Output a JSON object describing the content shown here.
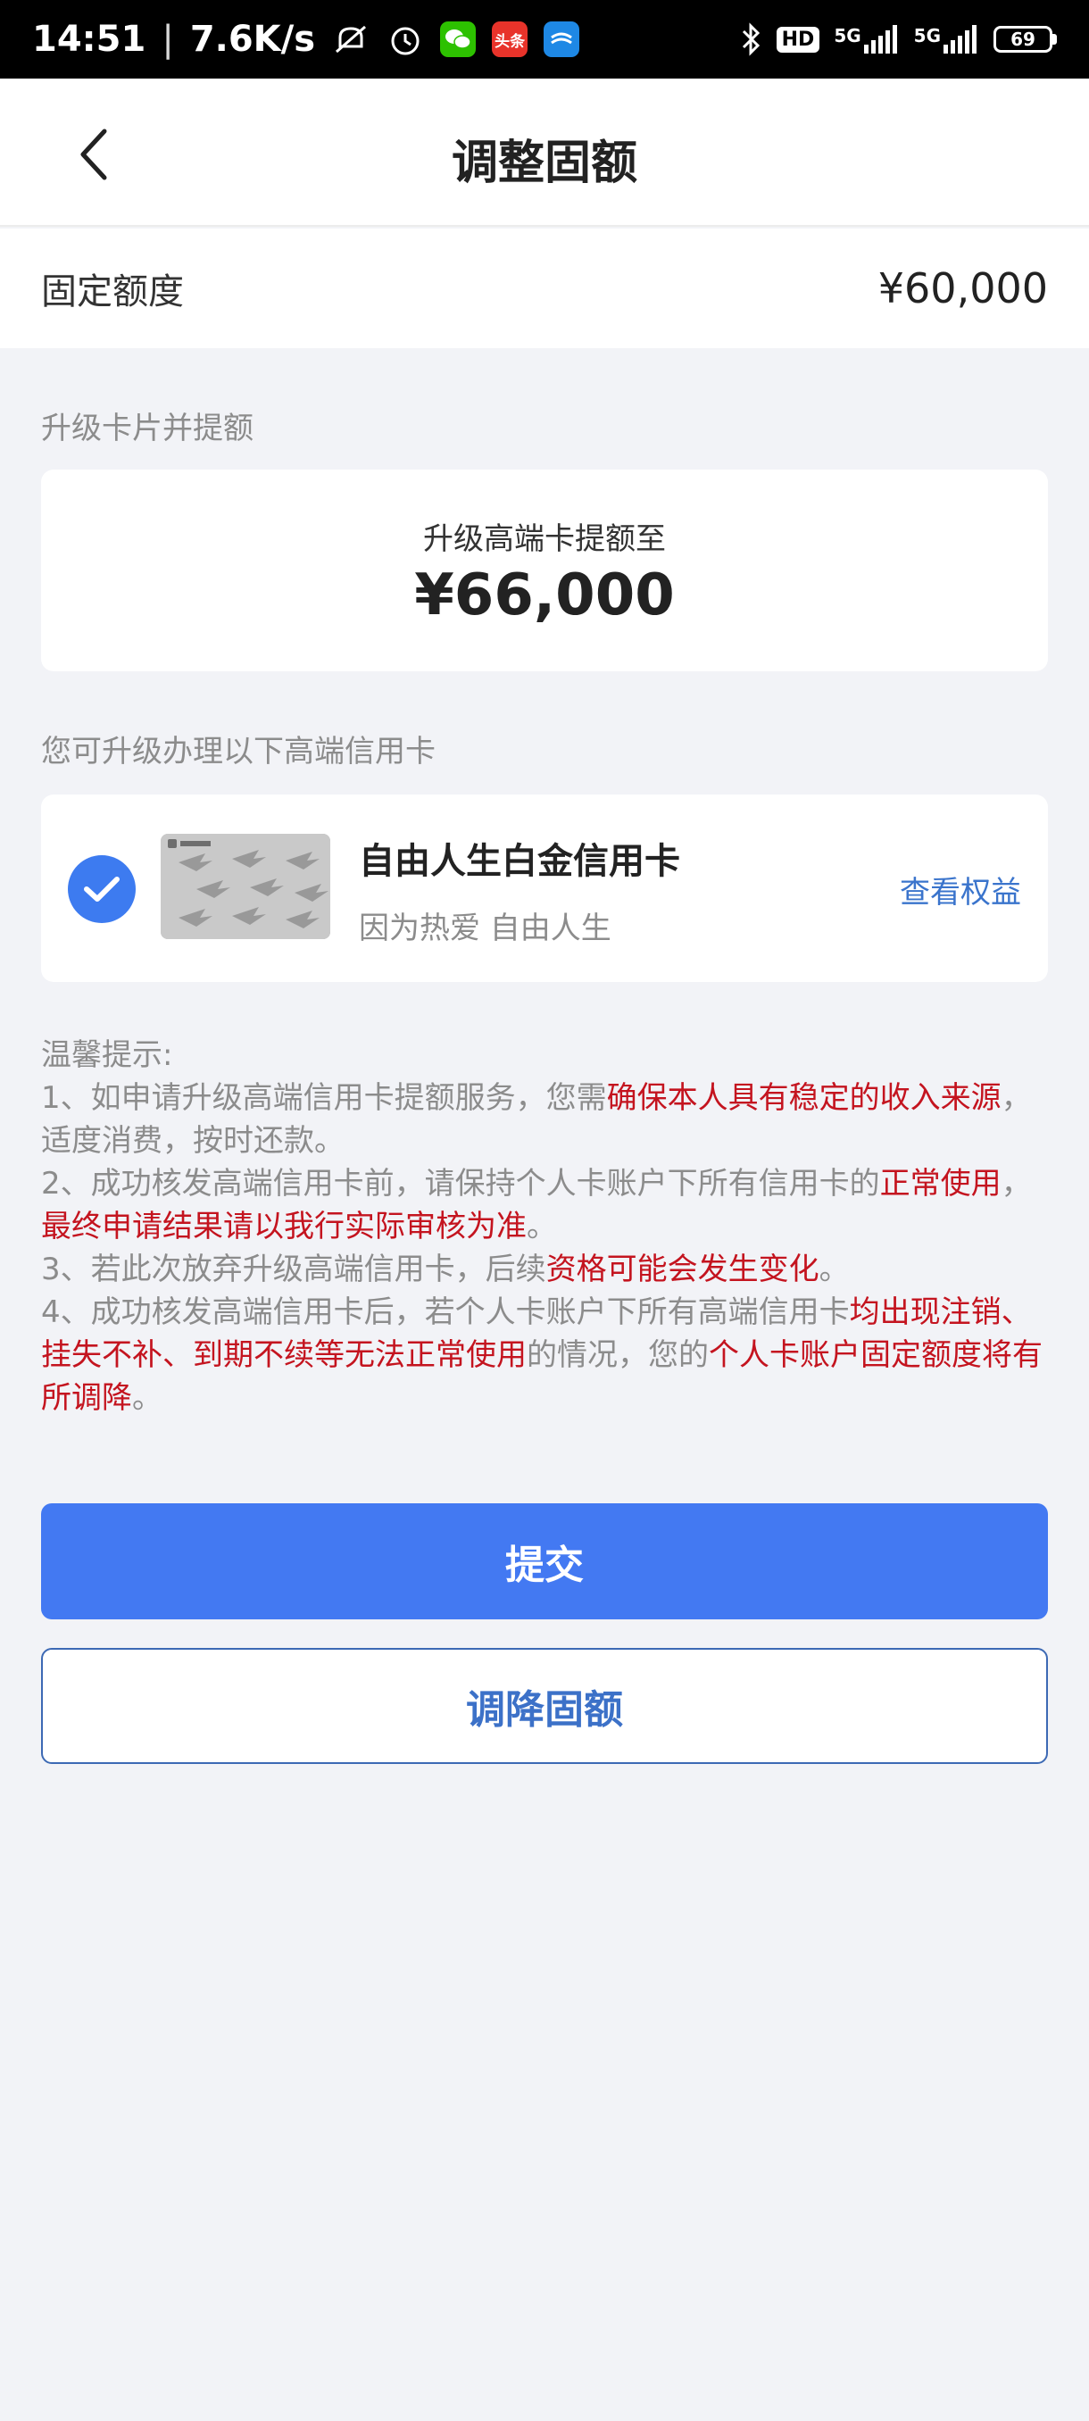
{
  "status_bar": {
    "time": "14:51",
    "speed": "7.6K/s",
    "toutiao_badge": "头条",
    "hd_badge": "HD",
    "sim1_network": "5G",
    "sim2_network": "5G",
    "battery": "69"
  },
  "nav": {
    "title": "调整固额"
  },
  "fixed_limit": {
    "label": "固定额度",
    "value": "¥60,000"
  },
  "upgrade_section": {
    "label": "升级卡片并提额",
    "subtitle": "升级高端卡提额至",
    "amount": "¥66,000"
  },
  "card_section": {
    "label": "您可升级办理以下高端信用卡",
    "card_name": "自由人生白金信用卡",
    "slogan": "因为热爱 自由人生",
    "link": "查看权益",
    "selected": true
  },
  "tips": {
    "title": "温馨提示:",
    "items": [
      [
        {
          "text": "1、如申请升级高端信用卡提额服务，您需",
          "red": false
        },
        {
          "text": "确保本人具有稳定的收入来源",
          "red": true
        },
        {
          "text": "，适度消费，按时还款。",
          "red": false
        }
      ],
      [
        {
          "text": "2、成功核发高端信用卡前，请保持个人卡账户下所有信用卡的",
          "red": false
        },
        {
          "text": "正常使用",
          "red": true
        },
        {
          "text": "，",
          "red": false
        },
        {
          "text": "最终申请结果请以我行实际审核为准",
          "red": true
        },
        {
          "text": "。",
          "red": false
        }
      ],
      [
        {
          "text": "3、若此次放弃升级高端信用卡，后续",
          "red": false
        },
        {
          "text": "资格可能会发生变化",
          "red": true
        },
        {
          "text": "。",
          "red": false
        }
      ],
      [
        {
          "text": "4、成功核发高端信用卡后，若个人卡账户下所有高端信用卡",
          "red": false
        },
        {
          "text": "均出现注销、挂失不补、到期不续等无法正常使用",
          "red": true
        },
        {
          "text": "的情况，您的",
          "red": false
        },
        {
          "text": "个人卡账户固定额度将有所调降",
          "red": true
        },
        {
          "text": "。",
          "red": false
        }
      ]
    ]
  },
  "buttons": {
    "submit": "提交",
    "decrease": "调降固额"
  },
  "colors": {
    "primary": "#4379F2",
    "link": "#3A74CC",
    "warning_red": "#C4141F",
    "page_bg": "#F2F3F7"
  }
}
